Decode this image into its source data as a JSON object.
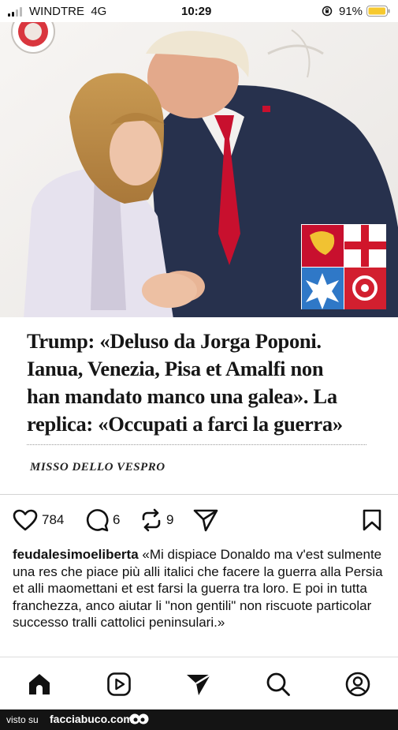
{
  "status_bar": {
    "carrier": "WINDTRE",
    "network": "4G",
    "time": "10:29",
    "battery_percent": "91%",
    "battery_level": 0.91
  },
  "post_image": {
    "description_icons": [
      "maritime-republics-flag-icon",
      "seal-icon"
    ]
  },
  "headline": {
    "line1": "Trump: «Deluso da Jorga Poponi.",
    "line2": "Ianua, Venezia, Pisa et Amalfi non",
    "line3": "han mandato manco una galea». La",
    "line4": "replica: «Occupati a farci la guerra»",
    "byline": "MISSO DELLO VESPRO"
  },
  "actions": {
    "likes": "784",
    "comments": "6",
    "reposts": "9"
  },
  "caption": {
    "username": "feudalesimoeliberta",
    "text": "«Mi dispiace Donaldo ma v'est sulmente una res che piace più alli italici che facere la guerra alla Persia et alli maomettani et est farsi la guerra tra loro. E poi in tutta franchezza, anco aiutar li \"non gentili\" non riscuote particolar successo tralli cattolici peninsulari.»"
  },
  "bottom_nav": {
    "items": [
      "home-icon",
      "reels-icon",
      "send-icon",
      "search-icon",
      "profile-icon"
    ]
  },
  "watermark": {
    "prefix": "visto su",
    "site": "facciabuco.com"
  },
  "colors": {
    "accent_red": "#c8102e",
    "flag_gold": "#f1c232",
    "flag_blue": "#2f78c7",
    "suit_navy": "#27314d"
  }
}
